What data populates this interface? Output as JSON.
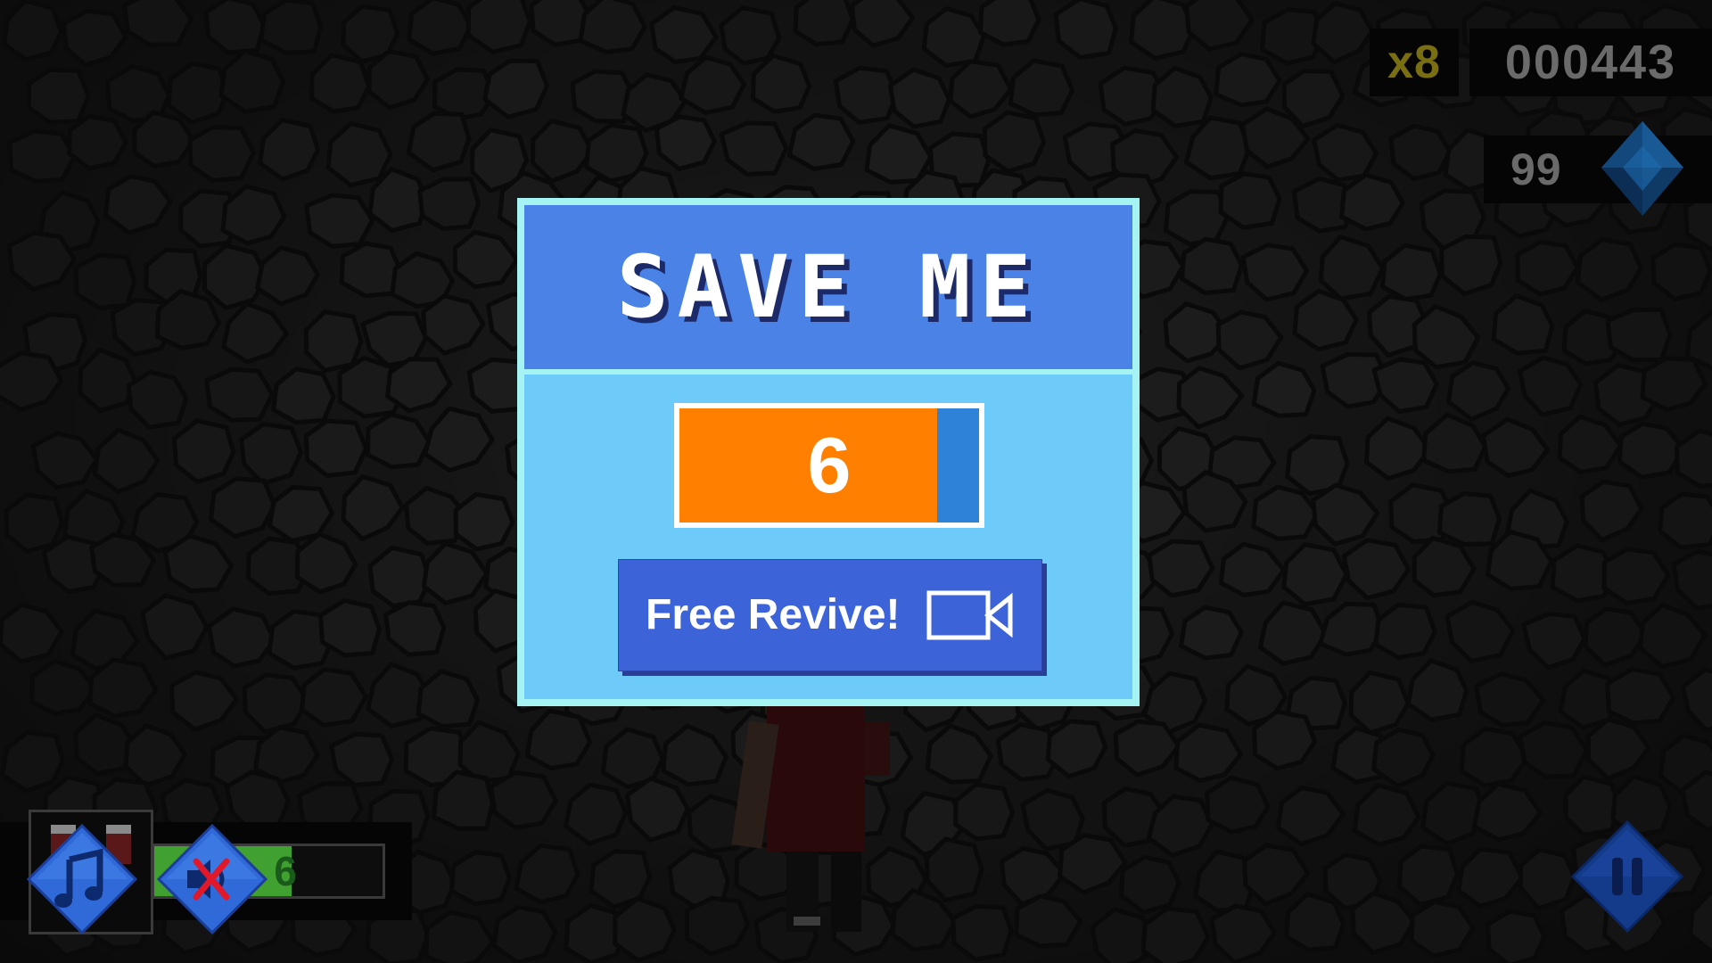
{
  "hud": {
    "multiplier": "x8",
    "score": "000443",
    "gems": "99",
    "gem_icon": "blue-gem-icon"
  },
  "dialog": {
    "title": "SAVE ME",
    "countdown": "6",
    "countdown_fill_fraction": 0.86,
    "revive_label": "Free Revive!",
    "revive_icon": "video-camera-icon"
  },
  "bottom_hud": {
    "powerup_count": "6",
    "powerup_progress_fraction": 0.6,
    "music_icon": "music-note-icon",
    "sound_icon": "speaker-muted-icon",
    "pause_icon": "pause-icon"
  },
  "colors": {
    "header_blue": "#4a82e6",
    "body_blue": "#6ecaf8",
    "timer_orange": "#ff7f00",
    "button_blue": "#3c64d8",
    "multiplier_gold": "#7a6e12"
  }
}
